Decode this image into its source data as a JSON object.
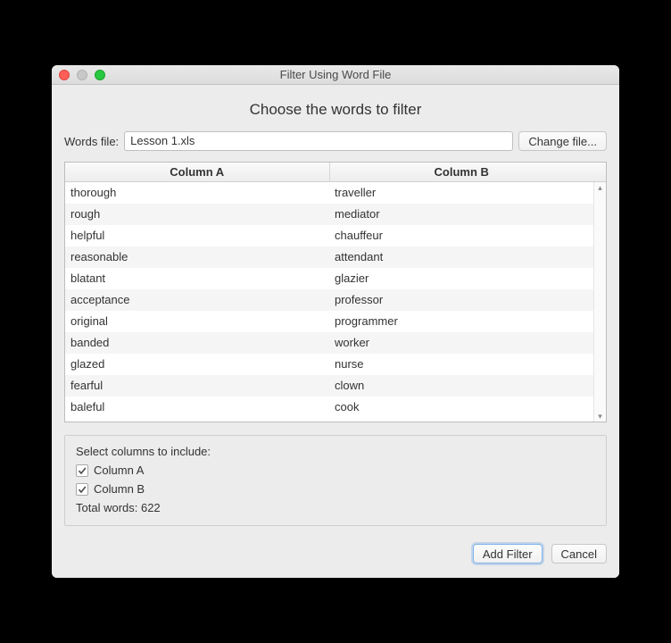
{
  "window": {
    "title": "Filter Using Word File"
  },
  "heading": "Choose the words to filter",
  "file": {
    "label": "Words file:",
    "value": "Lesson 1.xls",
    "change_btn": "Change file..."
  },
  "table": {
    "headers": {
      "a": "Column A",
      "b": "Column B"
    },
    "rows": [
      {
        "a": "thorough",
        "b": "traveller"
      },
      {
        "a": "rough",
        "b": "mediator"
      },
      {
        "a": "helpful",
        "b": "chauffeur"
      },
      {
        "a": "reasonable",
        "b": "attendant"
      },
      {
        "a": "blatant",
        "b": "glazier"
      },
      {
        "a": "acceptance",
        "b": "professor"
      },
      {
        "a": "original",
        "b": "programmer"
      },
      {
        "a": "banded",
        "b": "worker"
      },
      {
        "a": "glazed",
        "b": "nurse"
      },
      {
        "a": "fearful",
        "b": "clown"
      },
      {
        "a": "baleful",
        "b": "cook"
      }
    ]
  },
  "columns_group": {
    "title": "Select columns to include:",
    "col_a": "Column A",
    "col_b": "Column B",
    "total_label": "Total words: 622"
  },
  "actions": {
    "add_filter": "Add Filter",
    "cancel": "Cancel"
  }
}
